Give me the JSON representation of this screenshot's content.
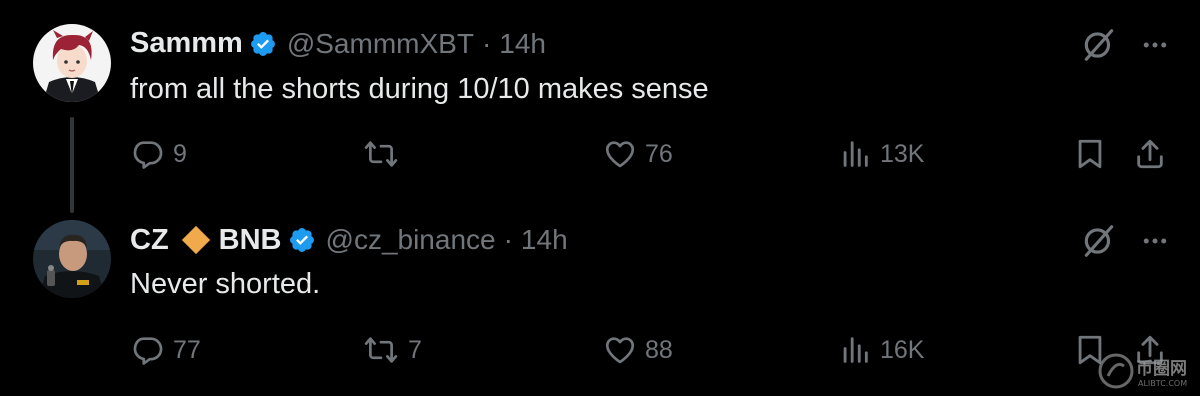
{
  "tweets": [
    {
      "author": "Sammm",
      "handle": "@SammmXBT",
      "separator": "·",
      "time": "14h",
      "text": "from all the shorts during 10/10 makes sense",
      "replies": "9",
      "reposts": "",
      "likes": "76",
      "views": "13K"
    },
    {
      "author_prefix": "CZ",
      "author_suffix": "BNB",
      "handle": "@cz_binance",
      "separator": "·",
      "time": "14h",
      "text": "Never shorted.",
      "replies": "77",
      "reposts": "7",
      "likes": "88",
      "views": "16K"
    }
  ],
  "colors": {
    "background": "#000000",
    "text": "#e7e9ea",
    "muted": "#71767b",
    "verified": "#1d9bf0",
    "bnb_diamond": "#f0a94b"
  },
  "icons": [
    "verified-badge-icon",
    "grok-icon",
    "more-icon",
    "reply-icon",
    "repost-icon",
    "like-icon",
    "views-icon",
    "bookmark-icon",
    "share-icon"
  ],
  "watermark": {
    "main": "币圈网",
    "sub": "ALIBTC.COM"
  }
}
